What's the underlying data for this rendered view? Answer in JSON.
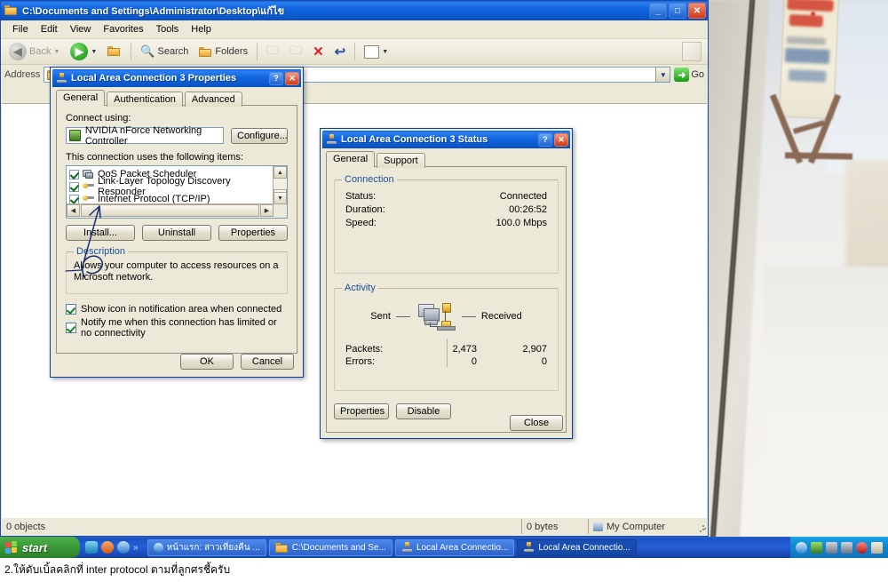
{
  "explorer": {
    "title": "C:\\Documents and Settings\\Administrator\\Desktop\\แก้ไข",
    "title_icon": "folder-icon",
    "menu": [
      "File",
      "Edit",
      "View",
      "Favorites",
      "Tools",
      "Help"
    ],
    "toolbar": {
      "back": "Back",
      "search": "Search",
      "folders": "Folders",
      "icons": [
        "back-arrow-icon",
        "forward-arrow-icon",
        "up-folder-icon",
        "search-icon",
        "folders-icon",
        "move-to-icon",
        "copy-to-icon",
        "delete-icon",
        "undo-icon",
        "views-icon"
      ]
    },
    "address": {
      "label": "Address",
      "value": "",
      "go_label": "Go"
    },
    "statusbar": {
      "objects": "0 objects",
      "size": "0 bytes",
      "zone": "My Computer"
    },
    "window_buttons": {
      "minimize": "_",
      "maximize": "□",
      "close": "✕"
    }
  },
  "properties_dialog": {
    "title": "Local Area Connection 3 Properties",
    "help_button": "?",
    "close_button": "✕",
    "tabs": [
      {
        "label": "General",
        "active": true
      },
      {
        "label": "Authentication",
        "active": false
      },
      {
        "label": "Advanced",
        "active": false
      }
    ],
    "connect_using_label": "Connect using:",
    "adapter": "NVIDIA nForce Networking Controller",
    "configure_button": "Configure...",
    "items_label": "This connection uses the following items:",
    "items": [
      {
        "label": "QoS Packet Scheduler",
        "checked": true,
        "icon": "computer-icon"
      },
      {
        "label": "Link-Layer Topology Discovery Responder",
        "checked": true,
        "icon": "protocol-icon"
      },
      {
        "label": "Internet Protocol (TCP/IP)",
        "checked": true,
        "icon": "protocol-icon"
      }
    ],
    "buttons": {
      "install": "Install...",
      "uninstall": "Uninstall",
      "properties": "Properties"
    },
    "description": {
      "legend": "Description",
      "text": "Allows your computer to access resources on a Microsoft network."
    },
    "checkboxes": [
      {
        "label": "Show icon in notification area when connected",
        "checked": true
      },
      {
        "label": "Notify me when this connection has limited or no connectivity",
        "checked": true
      }
    ],
    "ok_button": "OK",
    "cancel_button": "Cancel"
  },
  "status_dialog": {
    "title": "Local Area Connection 3 Status",
    "help_button": "?",
    "close_button": "✕",
    "tabs": [
      {
        "label": "General",
        "active": true
      },
      {
        "label": "Support",
        "active": false
      }
    ],
    "connection": {
      "legend": "Connection",
      "rows": [
        {
          "key": "Status:",
          "value": "Connected"
        },
        {
          "key": "Duration:",
          "value": "00:26:52"
        },
        {
          "key": "Speed:",
          "value": "100.0 Mbps"
        }
      ]
    },
    "activity": {
      "legend": "Activity",
      "sent_label": "Sent",
      "received_label": "Received",
      "icon": "network-activity-icon",
      "rows": [
        {
          "key": "Packets:",
          "sent": "2,473",
          "received": "2,907"
        },
        {
          "key": "Errors:",
          "sent": "0",
          "received": "0"
        }
      ]
    },
    "properties_button": "Properties",
    "disable_button": "Disable",
    "close_button_label": "Close"
  },
  "taskbar": {
    "start_label": "start",
    "quick_launch_icons": [
      "show-desktop-icon",
      "media-player-icon",
      "internet-explorer-icon",
      "chevron-more-icon"
    ],
    "tasks": [
      {
        "label": "หน้าแรก: สาวเที่ยงคืน ...",
        "icon": "internet-explorer-icon"
      },
      {
        "label": "C:\\Documents and Se...",
        "icon": "folder-icon"
      },
      {
        "label": "Local Area Connectio...",
        "icon": "network-icon"
      },
      {
        "label": "Local Area Connectio...",
        "icon": "network-icon",
        "active": true
      }
    ],
    "tray_icons": [
      "ie-icon",
      "shield-icon",
      "network-icon",
      "network2-icon",
      "av-icon",
      "battery-icon"
    ]
  },
  "caption": {
    "text": "2.ให้ดับเบิ้ลคลิกที่ inter protocol ตามที่ลูกศรชี้ครับ"
  },
  "annotations": {
    "arrow_target": "Internet Protocol (TCP/IP)",
    "circle_target": "Description",
    "color": "#1b2f6e"
  },
  "colors": {
    "titlebar_blue": "#0a5fd8",
    "dialog_face": "#ece9d8",
    "taskbar_blue": "#245fd6",
    "start_green": "#3c9a38",
    "group_legend": "#1c4f9c"
  }
}
